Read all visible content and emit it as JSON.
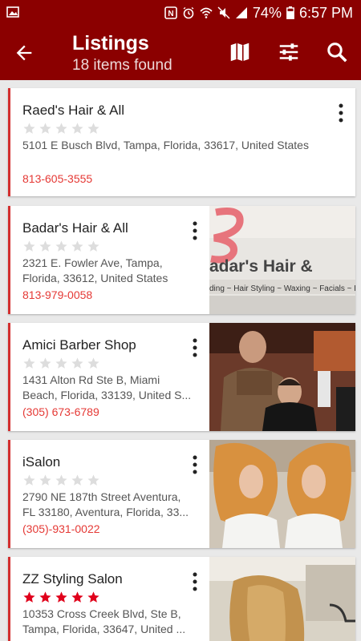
{
  "statusbar": {
    "battery": "74%",
    "time": "6:57 PM",
    "icons": [
      "image-icon",
      "nfc-icon",
      "alarm-icon",
      "wifi-icon",
      "silent-icon",
      "signal-icon",
      "battery-icon"
    ]
  },
  "appbar": {
    "title": "Listings",
    "subtitle": "18 items found",
    "icons": [
      "back-arrow-icon",
      "map-icon",
      "filter-icon",
      "search-icon"
    ]
  },
  "colors": {
    "primary": "#8b0000",
    "accent": "#d32f2f",
    "phone": "#e53935",
    "star_active": "#e0001b",
    "star_inactive": "#dddddd"
  },
  "listings": [
    {
      "name": "Raed's Hair & All",
      "rating": 0,
      "address": "5101 E Busch Blvd, Tampa, Florida, 33617, United States",
      "phone": "813-605-3555",
      "image": ""
    },
    {
      "name": "Badar's Hair & All",
      "rating": 0,
      "address": "2321 E. Fowler Ave, Tampa, Florida, 33612, United States",
      "phone": "813-979-0058",
      "image": "Badar's Hair & / ding ~ Hair Styling ~ Waxing ~ Facials ~ Laser"
    },
    {
      "name": "Amici Barber Shop",
      "rating": 0,
      "address": "1431 Alton Rd Ste B, Miami Beach, Florida, 33139, United S...",
      "phone": "(305) 673-6789",
      "image": "barber-photo"
    },
    {
      "name": "iSalon",
      "rating": 0,
      "address": "2790 NE 187th Street  Aventura, FL 33180, Aventura, Florida, 33...",
      "phone": "(305)-931-0022",
      "image": "salon-photo"
    },
    {
      "name": "ZZ Styling Salon",
      "rating": 5,
      "address": "10353 Cross Creek Blvd, Ste B, Tampa, Florida, 33647, United ...",
      "phone": "",
      "image": "salon-photo"
    }
  ]
}
